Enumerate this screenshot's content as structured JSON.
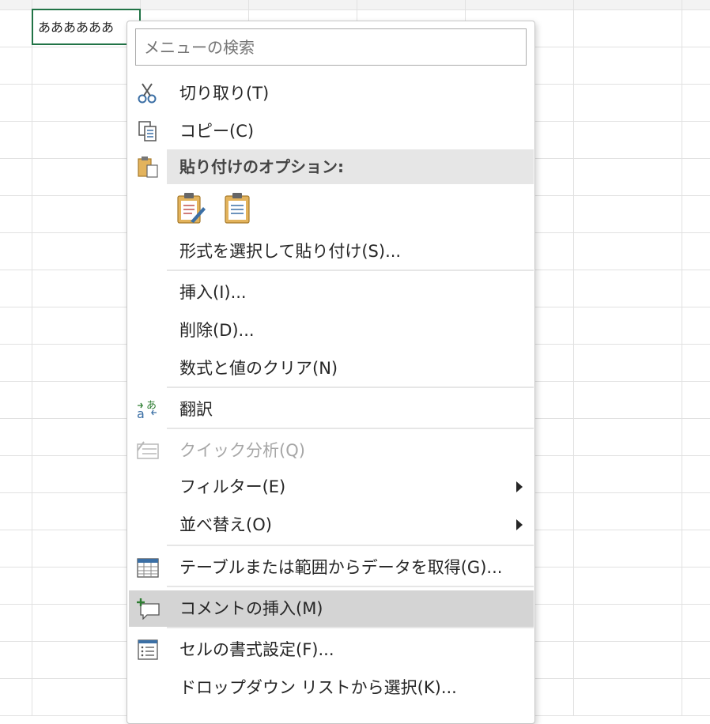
{
  "sheet": {
    "cell_text": "ああああああ"
  },
  "menu": {
    "search_placeholder": "メニューの検索",
    "paste_header": "貼り付けのオプション:",
    "items": {
      "cut": "切り取り(T)",
      "copy": "コピー(C)",
      "paste_special": "形式を選択して貼り付け(S)...",
      "insert": "挿入(I)...",
      "delete": "削除(D)...",
      "clear": "数式と値のクリア(N)",
      "translate": "翻訳",
      "quick_analysis": "クイック分析(Q)",
      "filter": "フィルター(E)",
      "sort": "並べ替え(O)",
      "get_data": "テーブルまたは範囲からデータを取得(G)...",
      "insert_comment": "コメントの挿入(M)",
      "format_cells": "セルの書式設定(F)...",
      "dropdown_list": "ドロップダウン リストから選択(K)..."
    }
  }
}
